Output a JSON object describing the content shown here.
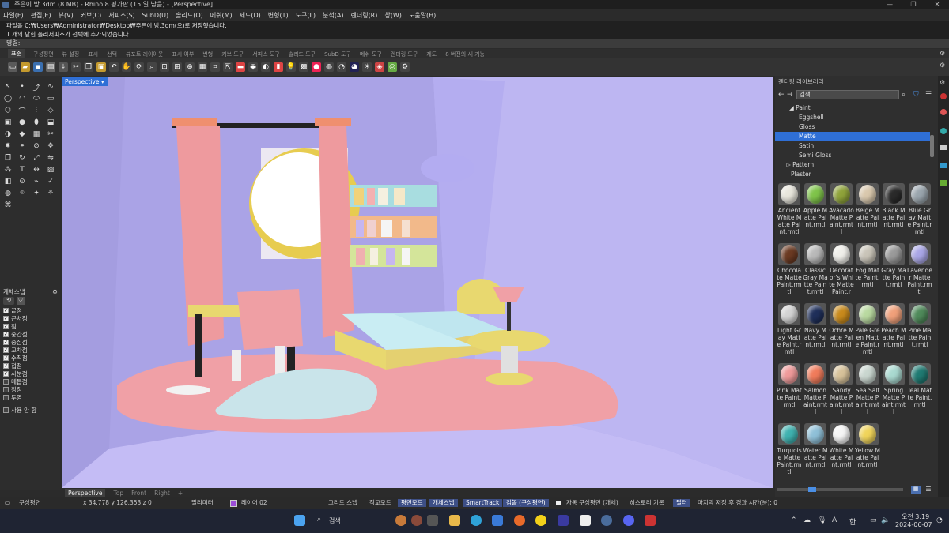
{
  "title": "주은이 방.3dm (8 MB) - Rhino 8 평가판 (15 일 남음) - [Perspective]",
  "menus": [
    "파일(F)",
    "편집(E)",
    "뷰(V)",
    "커브(C)",
    "서피스(S)",
    "SubD(U)",
    "솔리드(O)",
    "메쉬(M)",
    "제도(D)",
    "변형(T)",
    "도구(L)",
    "분석(A)",
    "렌더링(R)",
    "창(W)",
    "도움말(H)"
  ],
  "history": [
    "파일을 C:₩Users₩Administrator₩Desktop₩주은이 방.3dm(으)로 저장했습니다.",
    "1 개의 닫힌 폴리서피스가 선택에 추가되었습니다."
  ],
  "command_prompt": "명령:",
  "toolbar_tabs": [
    "표준",
    "구성평면",
    "뷰 설정",
    "표시",
    "선택",
    "뷰포트 레이아웃",
    "표시 여부",
    "변형",
    "커브 도구",
    "서피스 도구",
    "솔리드 도구",
    "SubD 도구",
    "메쉬 도구",
    "렌더링 도구",
    "제도",
    "8 버전의 새 기능"
  ],
  "viewport": {
    "label": "Perspective",
    "tabs": [
      "Perspective",
      "Top",
      "Front",
      "Right",
      "+"
    ]
  },
  "osnap": {
    "title": "개체스냅",
    "items": [
      {
        "label": "끝점",
        "on": true
      },
      {
        "label": "근처점",
        "on": true
      },
      {
        "label": "점",
        "on": true
      },
      {
        "label": "중간점",
        "on": true
      },
      {
        "label": "중심점",
        "on": true
      },
      {
        "label": "교차점",
        "on": true
      },
      {
        "label": "수직점",
        "on": true
      },
      {
        "label": "접점",
        "on": true
      },
      {
        "label": "사분점",
        "on": true
      },
      {
        "label": "매듭점",
        "on": false
      },
      {
        "label": "정점",
        "on": false
      },
      {
        "label": "투영",
        "on": false
      }
    ],
    "disable": "사용 안 함"
  },
  "library": {
    "title": "렌더링 라이브러리",
    "search_placeholder": "검색",
    "tree": [
      {
        "label": "◢ Paint",
        "indent": 18,
        "sel": false
      },
      {
        "label": "Eggshell",
        "indent": 30,
        "sel": false
      },
      {
        "label": "Gloss",
        "indent": 30,
        "sel": false
      },
      {
        "label": "Matte",
        "indent": 30,
        "sel": true
      },
      {
        "label": "Satin",
        "indent": 30,
        "sel": false
      },
      {
        "label": "Semi Gloss",
        "indent": 30,
        "sel": false
      },
      {
        "label": "▷ Pattern",
        "indent": 14,
        "sel": false
      },
      {
        "label": "Plaster",
        "indent": 20,
        "sel": false
      }
    ],
    "materials": [
      {
        "name": "Ancient White Matte Paint.rmtl",
        "color": "#e8e6dc"
      },
      {
        "name": "Apple Matte Paint.rmtl",
        "color": "#7fc44a"
      },
      {
        "name": "Avacado Matte Paint.rmtl",
        "color": "#8fa33a"
      },
      {
        "name": "Beige Matte Paint.rmtl",
        "color": "#d9c8ad"
      },
      {
        "name": "Black Matte Paint.rmtl",
        "color": "#2a2a2a"
      },
      {
        "name": "Blue Gray Matte Paint.rmtl",
        "color": "#9aa5ad"
      },
      {
        "name": "Chocolate Matte Paint.rmtl",
        "color": "#6b3a22"
      },
      {
        "name": "Classic Gray Matte Paint.rmtl",
        "color": "#b9b9b9"
      },
      {
        "name": "Decorator's White Matte Paint.r",
        "color": "#f0efea"
      },
      {
        "name": "Fog Matte Paint.rmtl",
        "color": "#c9c4b8"
      },
      {
        "name": "Gray Matte Paint.rmtl",
        "color": "#9a9a9a"
      },
      {
        "name": "Lavender Matte Paint.rmtl",
        "color": "#a9a6e6"
      },
      {
        "name": "Light Gray Matte Paint.rmtl",
        "color": "#d3d3d3"
      },
      {
        "name": "Navy Matte Paint.rmtl",
        "color": "#1f2f5a"
      },
      {
        "name": "Ochre Matte Paint.rmtl",
        "color": "#c88a1c"
      },
      {
        "name": "Pale Green Matte Paint.rmtl",
        "color": "#b9d9a0"
      },
      {
        "name": "Peach Matte Paint.rmtl",
        "color": "#f0a07a"
      },
      {
        "name": "Pine Matte Paint.rmtl",
        "color": "#4f8a5a"
      },
      {
        "name": "Pink Matte Paint.rmtl",
        "color": "#ef9a9a"
      },
      {
        "name": "Salmon Matte Paint.rmtl",
        "color": "#f07b5b"
      },
      {
        "name": "Sandy Matte Paint.rmtl",
        "color": "#d7c29a"
      },
      {
        "name": "Sea Salt Matte Paint.rmtl",
        "color": "#c9d6cf"
      },
      {
        "name": "Spring Matte Paint.rmtl",
        "color": "#a9d9d0"
      },
      {
        "name": "Teal Matte Paint.rmtl",
        "color": "#1f7a72"
      },
      {
        "name": "Turquoise Matte Paint.rmtl",
        "color": "#3fb2b0"
      },
      {
        "name": "Water Matte Paint.rmtl",
        "color": "#8fc0d8"
      },
      {
        "name": "White Matte Paint.rmtl",
        "color": "#f5f5f5"
      },
      {
        "name": "Yellow Matte Paint.rmtl",
        "color": "#f0d45a"
      }
    ]
  },
  "status": {
    "cplane": "구성평면",
    "coords": "x 34.778   y 126.353   z 0",
    "units": "밀리미터",
    "layer": "레이어 02",
    "grid_snap": "그리드 스냅",
    "ortho": "직교모드",
    "planar": "평면모드",
    "osnap": "개체스냅",
    "smarttrack": "SmartTrack",
    "gumball": "검볼 (구성평면)",
    "auto_cplane": "자동 구성평면 (개체)",
    "history": "히스토리 기록",
    "filter": "필터",
    "save_info": "마지막 저장 후 경과 시간(분): 0"
  },
  "taskbar": {
    "search": "검색",
    "time": "오전 3:19",
    "date": "2024-06-07",
    "ime": "한",
    "ime2": "A"
  }
}
